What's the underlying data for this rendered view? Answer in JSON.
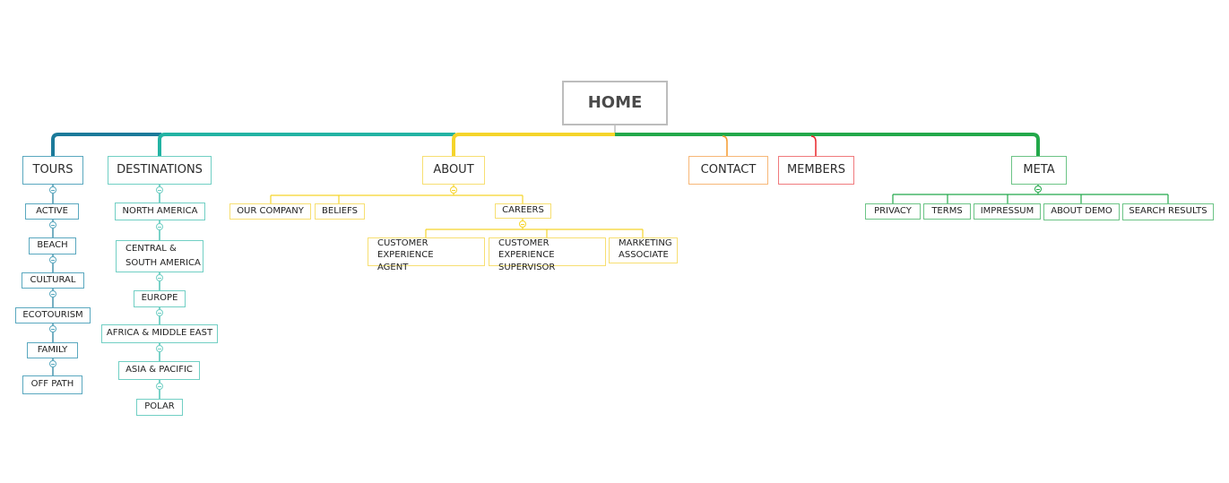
{
  "root": {
    "label": "HOME"
  },
  "branches": [
    {
      "key": "tours",
      "label": "TOURS",
      "color": "#1b7a9a",
      "border": "#5aa8bf",
      "children": [
        "ACTIVE",
        "BEACH",
        "CULTURAL",
        "ECOTOURISM",
        "FAMILY",
        "OFF PATH"
      ]
    },
    {
      "key": "destinations",
      "label": "DESTINATIONS",
      "color": "#22b3a3",
      "border": "#71cfc4",
      "children": [
        "NORTH AMERICA",
        "CENTRAL & SOUTH AMERICA",
        "EUROPE",
        "AFRICA & MIDDLE EAST",
        "ASIA & PACIFIC",
        "POLAR"
      ]
    },
    {
      "key": "about",
      "label": "ABOUT",
      "color": "#f5d42a",
      "border": "#f7df72",
      "children": [
        "OUR COMPANY",
        "BELIEFS",
        "CAREERS"
      ],
      "careers_children": [
        "CUSTOMER EXPERIENCE AGENT",
        "CUSTOMER EXPERIENCE SUPERVISOR",
        "MARKETING ASSOCIATE"
      ]
    },
    {
      "key": "contact",
      "label": "CONTACT",
      "color": "#f59a2f",
      "border": "#f7b777",
      "children": []
    },
    {
      "key": "members",
      "label": "MEMBERS",
      "color": "#e8262c",
      "border": "#f07a7d",
      "children": []
    },
    {
      "key": "meta",
      "label": "META",
      "color": "#22a84a",
      "border": "#6cc486",
      "children": [
        "PRIVACY",
        "TERMS",
        "IMPRESSUM",
        "ABOUT DEMO",
        "SEARCH RESULTS"
      ]
    }
  ],
  "labels": {
    "central_line1": "CENTRAL &",
    "central_line2": "SOUTH AMERICA",
    "cea_line1": "CUSTOMER EXPERIENCE",
    "cea_line2": "AGENT",
    "ces_line1": "CUSTOMER EXPERIENCE",
    "ces_line2": "SUPERVISOR",
    "ma_line1": "MARKETING",
    "ma_line2": "ASSOCIATE"
  }
}
